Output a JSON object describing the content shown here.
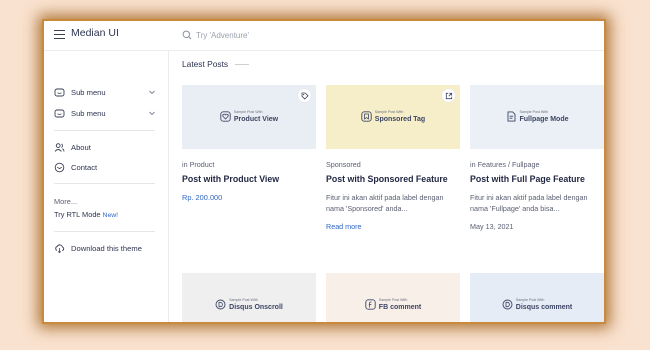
{
  "header": {
    "brand": "Median UI",
    "search_placeholder": "Try 'Adventure'"
  },
  "sidebar": {
    "submenus": [
      {
        "label": "Sub menu"
      },
      {
        "label": "Sub menu"
      }
    ],
    "about": "About",
    "contact": "Contact",
    "more": "More...",
    "rtl_mode": "Try RTL Mode",
    "rtl_new": "New!",
    "download": "Download this theme"
  },
  "main": {
    "section_title": "Latest Posts",
    "posts": [
      {
        "thumb_small": "Sample Post With",
        "thumb_big": "Product View",
        "thumb_bg": "#e9eef4",
        "category": "in Product",
        "title": "Post with Product View",
        "price": "Rp. 200.000"
      },
      {
        "thumb_small": "Sample Post With",
        "thumb_big": "Sponsored Tag",
        "thumb_bg": "#f6eec9",
        "category": "Sponsored",
        "title": "Post with Sponsored Feature",
        "description": "Fitur ini akan aktif pada label dengan nama 'Sponsored' anda...",
        "read_more": "Read more"
      },
      {
        "thumb_small": "Sample Post With",
        "thumb_big": "Fullpage Mode",
        "thumb_bg": "#eaf0f5",
        "category": "in Features / Fullpage",
        "title": "Post with Full Page Feature",
        "description": "Fitur ini akan aktif pada label dengan nama 'Fullpage' anda bisa...",
        "date": "May 13, 2021"
      },
      {
        "thumb_small": "Sample Post With",
        "thumb_big": "Disqus Onscroll",
        "thumb_bg": "#efefef"
      },
      {
        "thumb_small": "Sample Post With",
        "thumb_big": "FB comment",
        "thumb_bg": "#f8efe8"
      },
      {
        "thumb_small": "Sample Post With",
        "thumb_big": "Disqus comment",
        "thumb_bg": "#e6ecf6"
      }
    ]
  },
  "colors": {
    "accent": "#2f66c5",
    "text": "#232843",
    "page_bg": "#f9e2cf"
  }
}
